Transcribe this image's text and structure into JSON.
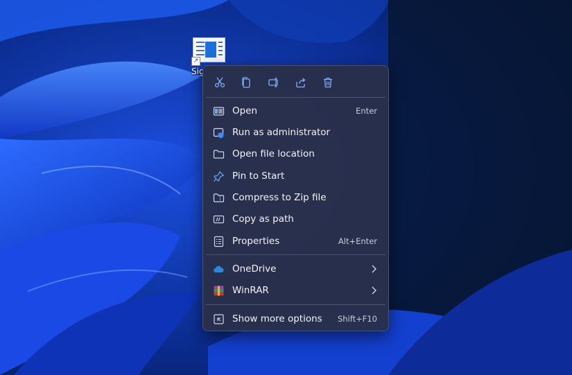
{
  "desktop": {
    "icon_label": "Sig",
    "icon_name": "document-shortcut-icon"
  },
  "toolbar": [
    {
      "name": "cut-button",
      "icon": "scissors-icon"
    },
    {
      "name": "copy-button",
      "icon": "copy-icon"
    },
    {
      "name": "rename-button",
      "icon": "rename-icon"
    },
    {
      "name": "share-button",
      "icon": "share-icon"
    },
    {
      "name": "delete-button",
      "icon": "trash-icon"
    }
  ],
  "menu": {
    "items": [
      {
        "label": "Open",
        "shortcut": "Enter",
        "icon": "app-window-icon"
      },
      {
        "label": "Run as administrator",
        "shortcut": "",
        "icon": "shield-window-icon"
      },
      {
        "label": "Open file location",
        "shortcut": "",
        "icon": "folder-icon"
      },
      {
        "label": "Pin to Start",
        "shortcut": "",
        "icon": "pin-icon"
      },
      {
        "label": "Compress to Zip file",
        "shortcut": "",
        "icon": "zip-folder-icon"
      },
      {
        "label": "Copy as path",
        "shortcut": "",
        "icon": "path-icon"
      },
      {
        "label": "Properties",
        "shortcut": "Alt+Enter",
        "icon": "properties-icon"
      }
    ],
    "integrations": [
      {
        "label": "OneDrive",
        "icon": "onedrive-icon",
        "has_submenu": true
      },
      {
        "label": "WinRAR",
        "icon": "winrar-icon",
        "has_submenu": true
      }
    ],
    "more_options": {
      "label": "Show more options",
      "shortcut": "Shift+F10",
      "icon": "more-options-icon"
    }
  },
  "colors": {
    "menu_bg": "#29304a",
    "icon_accent": "#6fa8ff",
    "onedrive": "#2f86d9",
    "separator": "#4b5372"
  }
}
